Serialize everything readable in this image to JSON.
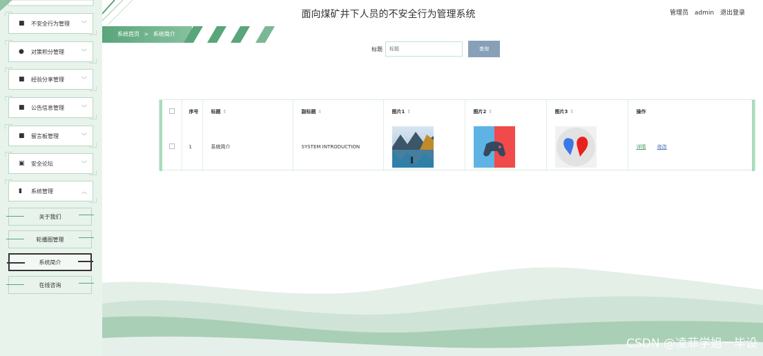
{
  "header": {
    "title": "面向煤矿井下人员的不安全行为管理系统",
    "user_role": "管理员",
    "username": "admin",
    "logout": "退出登录"
  },
  "breadcrumb": {
    "home": "系统首页",
    "separator": ">",
    "current": "系统简介"
  },
  "sidebar": {
    "items": [
      {
        "label": "不安全行为管理",
        "icon": "grid-icon",
        "chevron": "chevron-down-icon"
      },
      {
        "label": "对策积分管理",
        "icon": "user-icon",
        "chevron": "chevron-down-icon"
      },
      {
        "label": "经验分享管理",
        "icon": "grid-icon",
        "chevron": "chevron-down-icon"
      },
      {
        "label": "公告信息管理",
        "icon": "grid-icon",
        "chevron": "chevron-down-icon"
      },
      {
        "label": "留言板管理",
        "icon": "grid-icon",
        "chevron": "chevron-down-icon"
      },
      {
        "label": "安全论坛",
        "icon": "clipboard-icon",
        "chevron": "chevron-down-icon"
      },
      {
        "label": "系统管理",
        "icon": "book-icon",
        "chevron": "chevron-up-icon"
      }
    ],
    "sub_items": [
      {
        "label": "关于我们"
      },
      {
        "label": "轮播图管理"
      },
      {
        "label": "系统简介",
        "active": true
      },
      {
        "label": "在线咨询"
      }
    ]
  },
  "search": {
    "label": "标题",
    "placeholder": "标题",
    "button": "查询"
  },
  "table": {
    "headers": {
      "index": "序号",
      "title": "标题",
      "subtitle": "副标题",
      "image1": "图片1",
      "image2": "图片2",
      "image3": "图片3",
      "actions": "操作"
    },
    "rows": [
      {
        "index": "1",
        "title": "系统简介",
        "subtitle": "SYSTEM INTRODUCTION",
        "action_detail": "详情",
        "action_edit": "修改"
      }
    ]
  },
  "colors": {
    "accent_green": "#5aa57a",
    "sidebar_bg": "#e8f3ec",
    "search_button": "#87a0b8"
  },
  "watermark": "CSDN @凌菲学姐一毕设"
}
